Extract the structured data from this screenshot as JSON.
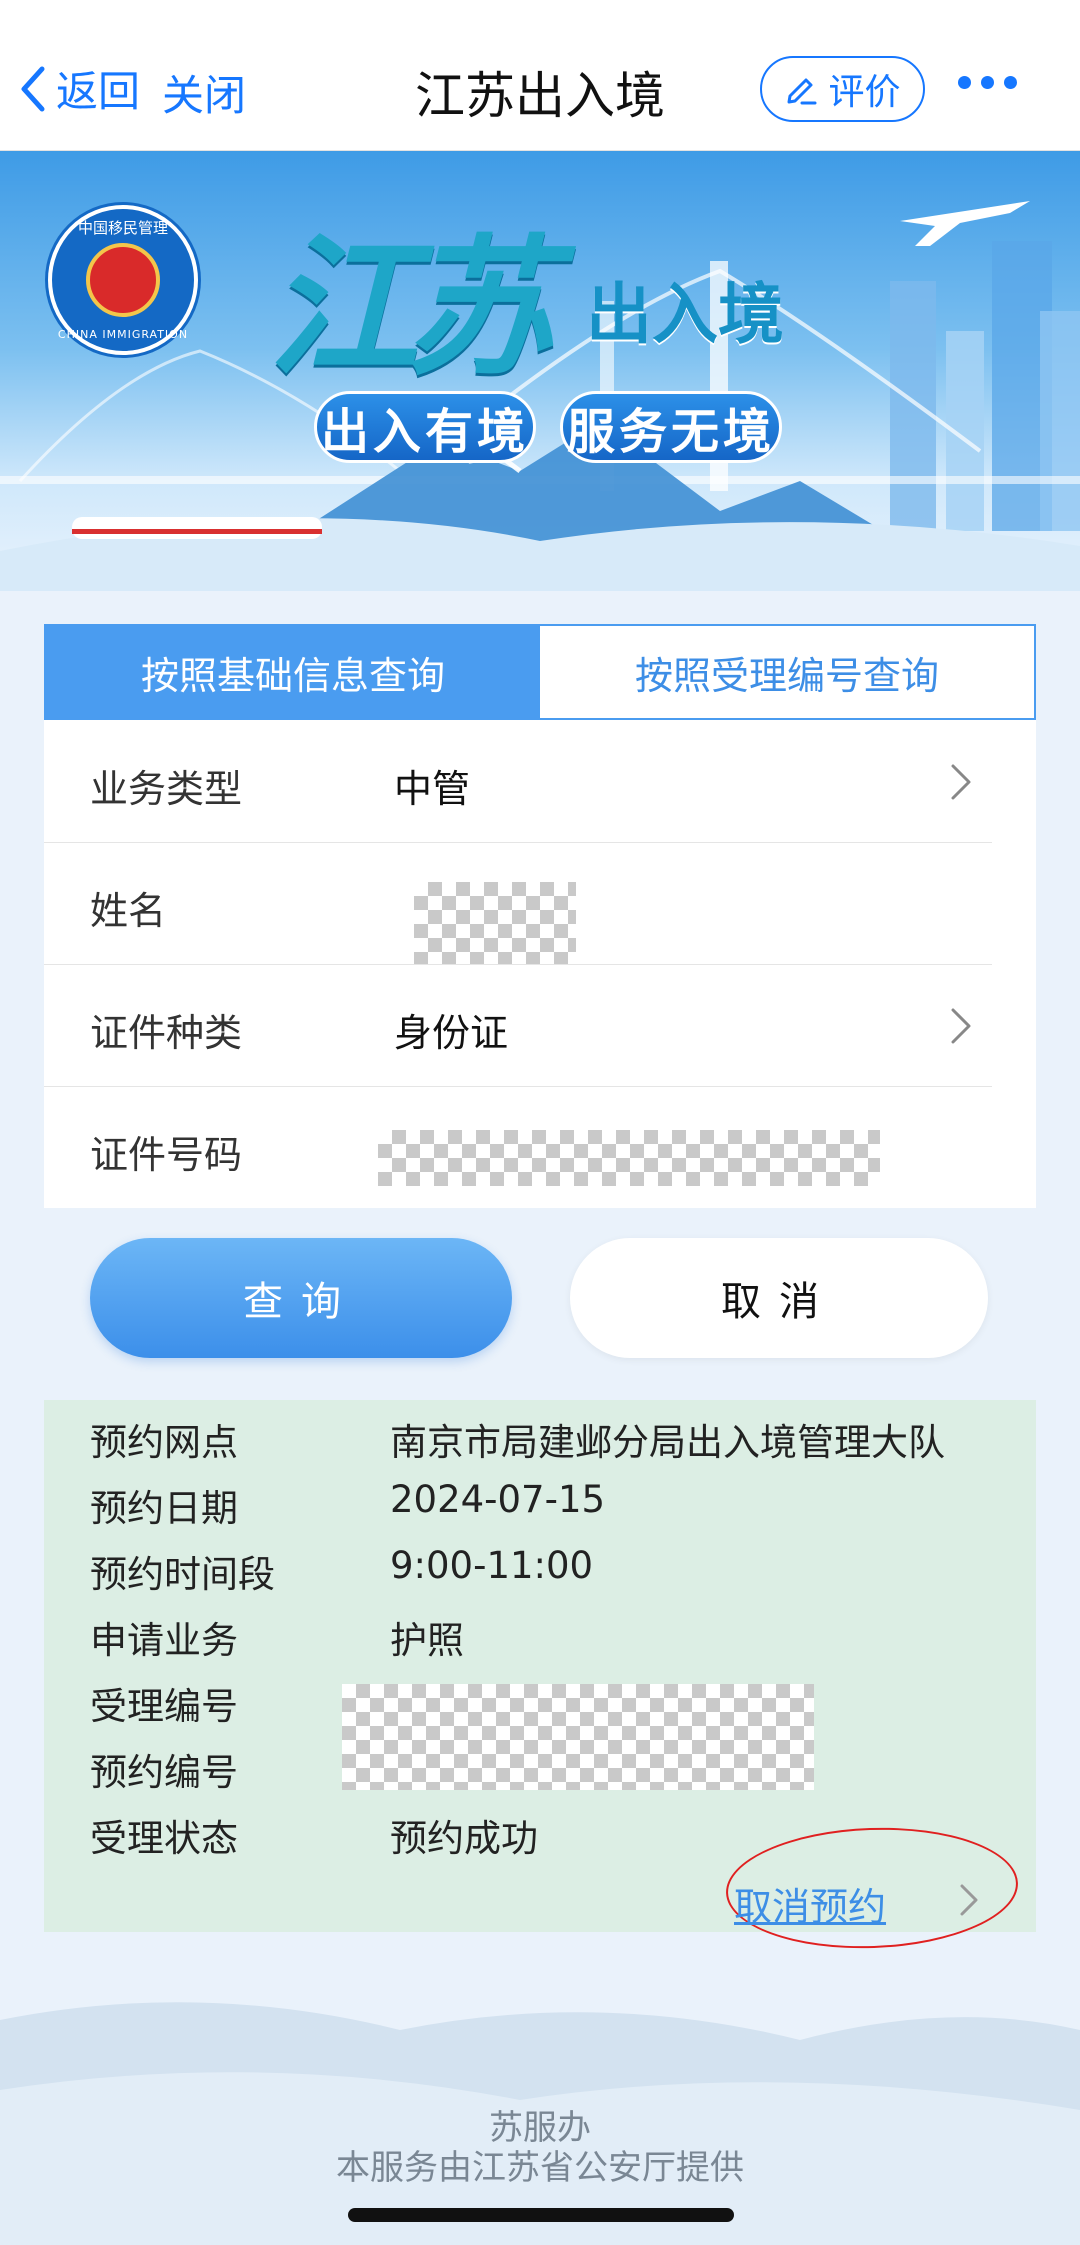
{
  "nav": {
    "back_label": "返回",
    "close_label": "关闭",
    "title": "江苏出入境",
    "rate_label": "评价"
  },
  "banner": {
    "brand_big": "江苏",
    "brand_small": "出入境",
    "slogan_1": "出入有境",
    "slogan_2": "服务无境",
    "emblem_top": "中国移民管理",
    "emblem_bottom": "CHINA IMMIGRATION"
  },
  "tabs": [
    {
      "label": "按照基础信息查询",
      "active": true
    },
    {
      "label": "按照受理编号查询",
      "active": false
    }
  ],
  "form": {
    "business_type": {
      "label": "业务类型",
      "value": "中管"
    },
    "name": {
      "label": "姓名"
    },
    "id_type": {
      "label": "证件种类",
      "value": "身份证"
    },
    "id_number": {
      "label": "证件号码"
    }
  },
  "buttons": {
    "query": "查询",
    "cancel": "取消"
  },
  "result": {
    "rows": [
      {
        "k": "预约网点",
        "v": "南京市局建邺分局出入境管理大队"
      },
      {
        "k": "预约日期",
        "v": "2024-07-15"
      },
      {
        "k": "预约时间段",
        "v": "9:00-11:00"
      },
      {
        "k": "申请业务",
        "v": "护照"
      },
      {
        "k": "受理编号",
        "v": ""
      },
      {
        "k": "预约编号",
        "v": ""
      },
      {
        "k": "受理状态",
        "v": "预约成功"
      }
    ],
    "cancel_link": "取消预约"
  },
  "footer": {
    "line1": "苏服办",
    "line2": "本服务由江苏省公安厅提供"
  },
  "colors": {
    "accent": "#1677ff",
    "tab_active": "#4a9cf0",
    "result_bg": "#dceee4",
    "annotation_red": "#e02020"
  }
}
